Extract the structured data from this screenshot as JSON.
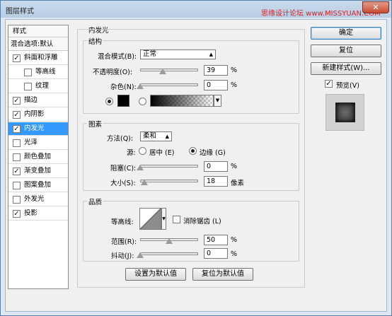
{
  "window": {
    "title": "图层样式",
    "watermark": "思缘设计论坛 www.MISSYUAN.COM",
    "close": "✕"
  },
  "styles_panel": {
    "header": "样式",
    "blend_options": "混合选项:默认",
    "items": [
      {
        "label": "斜面和浮雕",
        "checked": true,
        "indent": false,
        "selected": false
      },
      {
        "label": "等高线",
        "checked": false,
        "indent": true,
        "selected": false
      },
      {
        "label": "纹理",
        "checked": false,
        "indent": true,
        "selected": false
      },
      {
        "label": "描边",
        "checked": true,
        "indent": false,
        "selected": false
      },
      {
        "label": "内阴影",
        "checked": true,
        "indent": false,
        "selected": false
      },
      {
        "label": "内发光",
        "checked": true,
        "indent": false,
        "selected": true
      },
      {
        "label": "光泽",
        "checked": false,
        "indent": false,
        "selected": false
      },
      {
        "label": "颜色叠加",
        "checked": false,
        "indent": false,
        "selected": false
      },
      {
        "label": "渐变叠加",
        "checked": true,
        "indent": false,
        "selected": false
      },
      {
        "label": "图案叠加",
        "checked": false,
        "indent": false,
        "selected": false
      },
      {
        "label": "外发光",
        "checked": false,
        "indent": false,
        "selected": false
      },
      {
        "label": "投影",
        "checked": true,
        "indent": false,
        "selected": false
      }
    ]
  },
  "inner_glow": {
    "title": "内发光",
    "structure": {
      "title": "结构",
      "blend_mode_label": "混合模式(B):",
      "blend_mode_value": "正常",
      "opacity_label": "不透明度(O):",
      "opacity_value": "39",
      "opacity_fraction": 0.39,
      "noise_label": "杂色(N):",
      "noise_value": "0",
      "noise_fraction": 0.0,
      "percent": "%"
    },
    "elements": {
      "title": "图素",
      "technique_label": "方法(Q):",
      "technique_value": "柔和",
      "source_label": "源:",
      "source_center": "居中 (E)",
      "source_edge": "边缘 (G)",
      "choke_label": "阻塞(C):",
      "choke_value": "0",
      "choke_fraction": 0.0,
      "size_label": "大小(S):",
      "size_value": "18",
      "size_fraction": 0.07,
      "pixels": "像素",
      "percent": "%"
    },
    "quality": {
      "title": "品质",
      "contour_label": "等高线:",
      "anti_alias_label": "消除锯齿 (L)",
      "range_label": "范围(R):",
      "range_value": "50",
      "range_fraction": 0.5,
      "jitter_label": "抖动(J):",
      "jitter_value": "0",
      "jitter_fraction": 0.0,
      "percent": "%"
    },
    "set_default": "设置为默认值",
    "reset_default": "复位为默认值"
  },
  "buttons": {
    "ok": "确定",
    "reset": "复位",
    "new_style": "新建样式(W)...",
    "preview_label": "预览(V)",
    "preview_checked": true
  },
  "colors": {
    "selected": "#3399ff",
    "glow": "#000000"
  }
}
